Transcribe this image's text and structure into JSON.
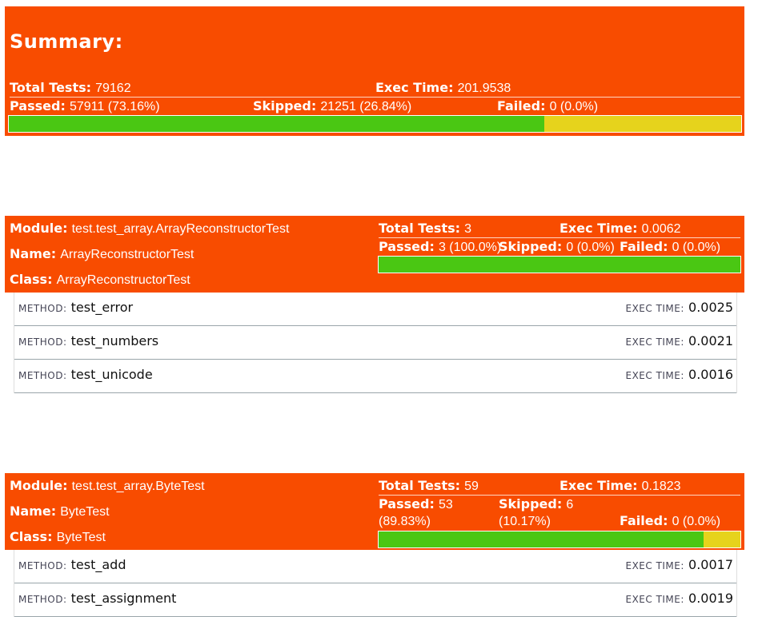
{
  "summary": {
    "title": "Summary:",
    "total_label": "Total Tests:",
    "total_value": "79162",
    "exec_label": "Exec Time:",
    "exec_value": "201.9538",
    "passed_label": "Passed:",
    "passed_value": "57911 (73.16%)",
    "skipped_label": "Skipped:",
    "skipped_value": "21251 (26.84%)",
    "failed_label": "Failed:",
    "failed_value": "0 (0.0%)",
    "pass_fraction": 0.7316,
    "skip_fraction": 0.2684
  },
  "modules": [
    {
      "module_label": "Module:",
      "module_value": "test.test_array.ArrayReconstructorTest",
      "name_label": "Name:",
      "name_value": "ArrayReconstructorTest",
      "class_label": "Class:",
      "class_value": "ArrayReconstructorTest",
      "total_label": "Total Tests:",
      "total_value": "3",
      "exec_label": "Exec Time:",
      "exec_value": "0.0062",
      "passed_label": "Passed:",
      "passed_value": "3 (100.0%)",
      "skipped_label": "Skipped:",
      "skipped_value": "0 (0.0%)",
      "failed_label": "Failed:",
      "failed_value": "0 (0.0%)",
      "pass_fraction": 1.0,
      "skip_fraction": 0.0,
      "methods": [
        {
          "label": "METHOD:",
          "name": "test_error",
          "time_label": "EXEC TIME:",
          "time": "0.0025"
        },
        {
          "label": "METHOD:",
          "name": "test_numbers",
          "time_label": "EXEC TIME:",
          "time": "0.0021"
        },
        {
          "label": "METHOD:",
          "name": "test_unicode",
          "time_label": "EXEC TIME:",
          "time": "0.0016"
        }
      ]
    },
    {
      "module_label": "Module:",
      "module_value": "test.test_array.ByteTest",
      "name_label": "Name:",
      "name_value": "ByteTest",
      "class_label": "Class:",
      "class_value": "ByteTest",
      "total_label": "Total Tests:",
      "total_value": "59",
      "exec_label": "Exec Time:",
      "exec_value": "0.1823",
      "passed_label": "Passed:",
      "passed_value_1": "53",
      "passed_value_2": "(89.83%)",
      "skipped_label": "Skipped:",
      "skipped_value_1": "6",
      "skipped_value_2": "(10.17%)",
      "failed_label": "Failed:",
      "failed_value": "0 (0.0%)",
      "pass_fraction": 0.8983,
      "skip_fraction": 0.1017,
      "methods": [
        {
          "label": "METHOD:",
          "name": "test_add",
          "time_label": "EXEC TIME:",
          "time": "0.0017"
        },
        {
          "label": "METHOD:",
          "name": "test_assignment",
          "time_label": "EXEC TIME:",
          "time": "0.0019"
        }
      ]
    }
  ],
  "colors": {
    "header": "#f84c00",
    "passed": "#4ac713",
    "skipped": "#e6d31c"
  }
}
